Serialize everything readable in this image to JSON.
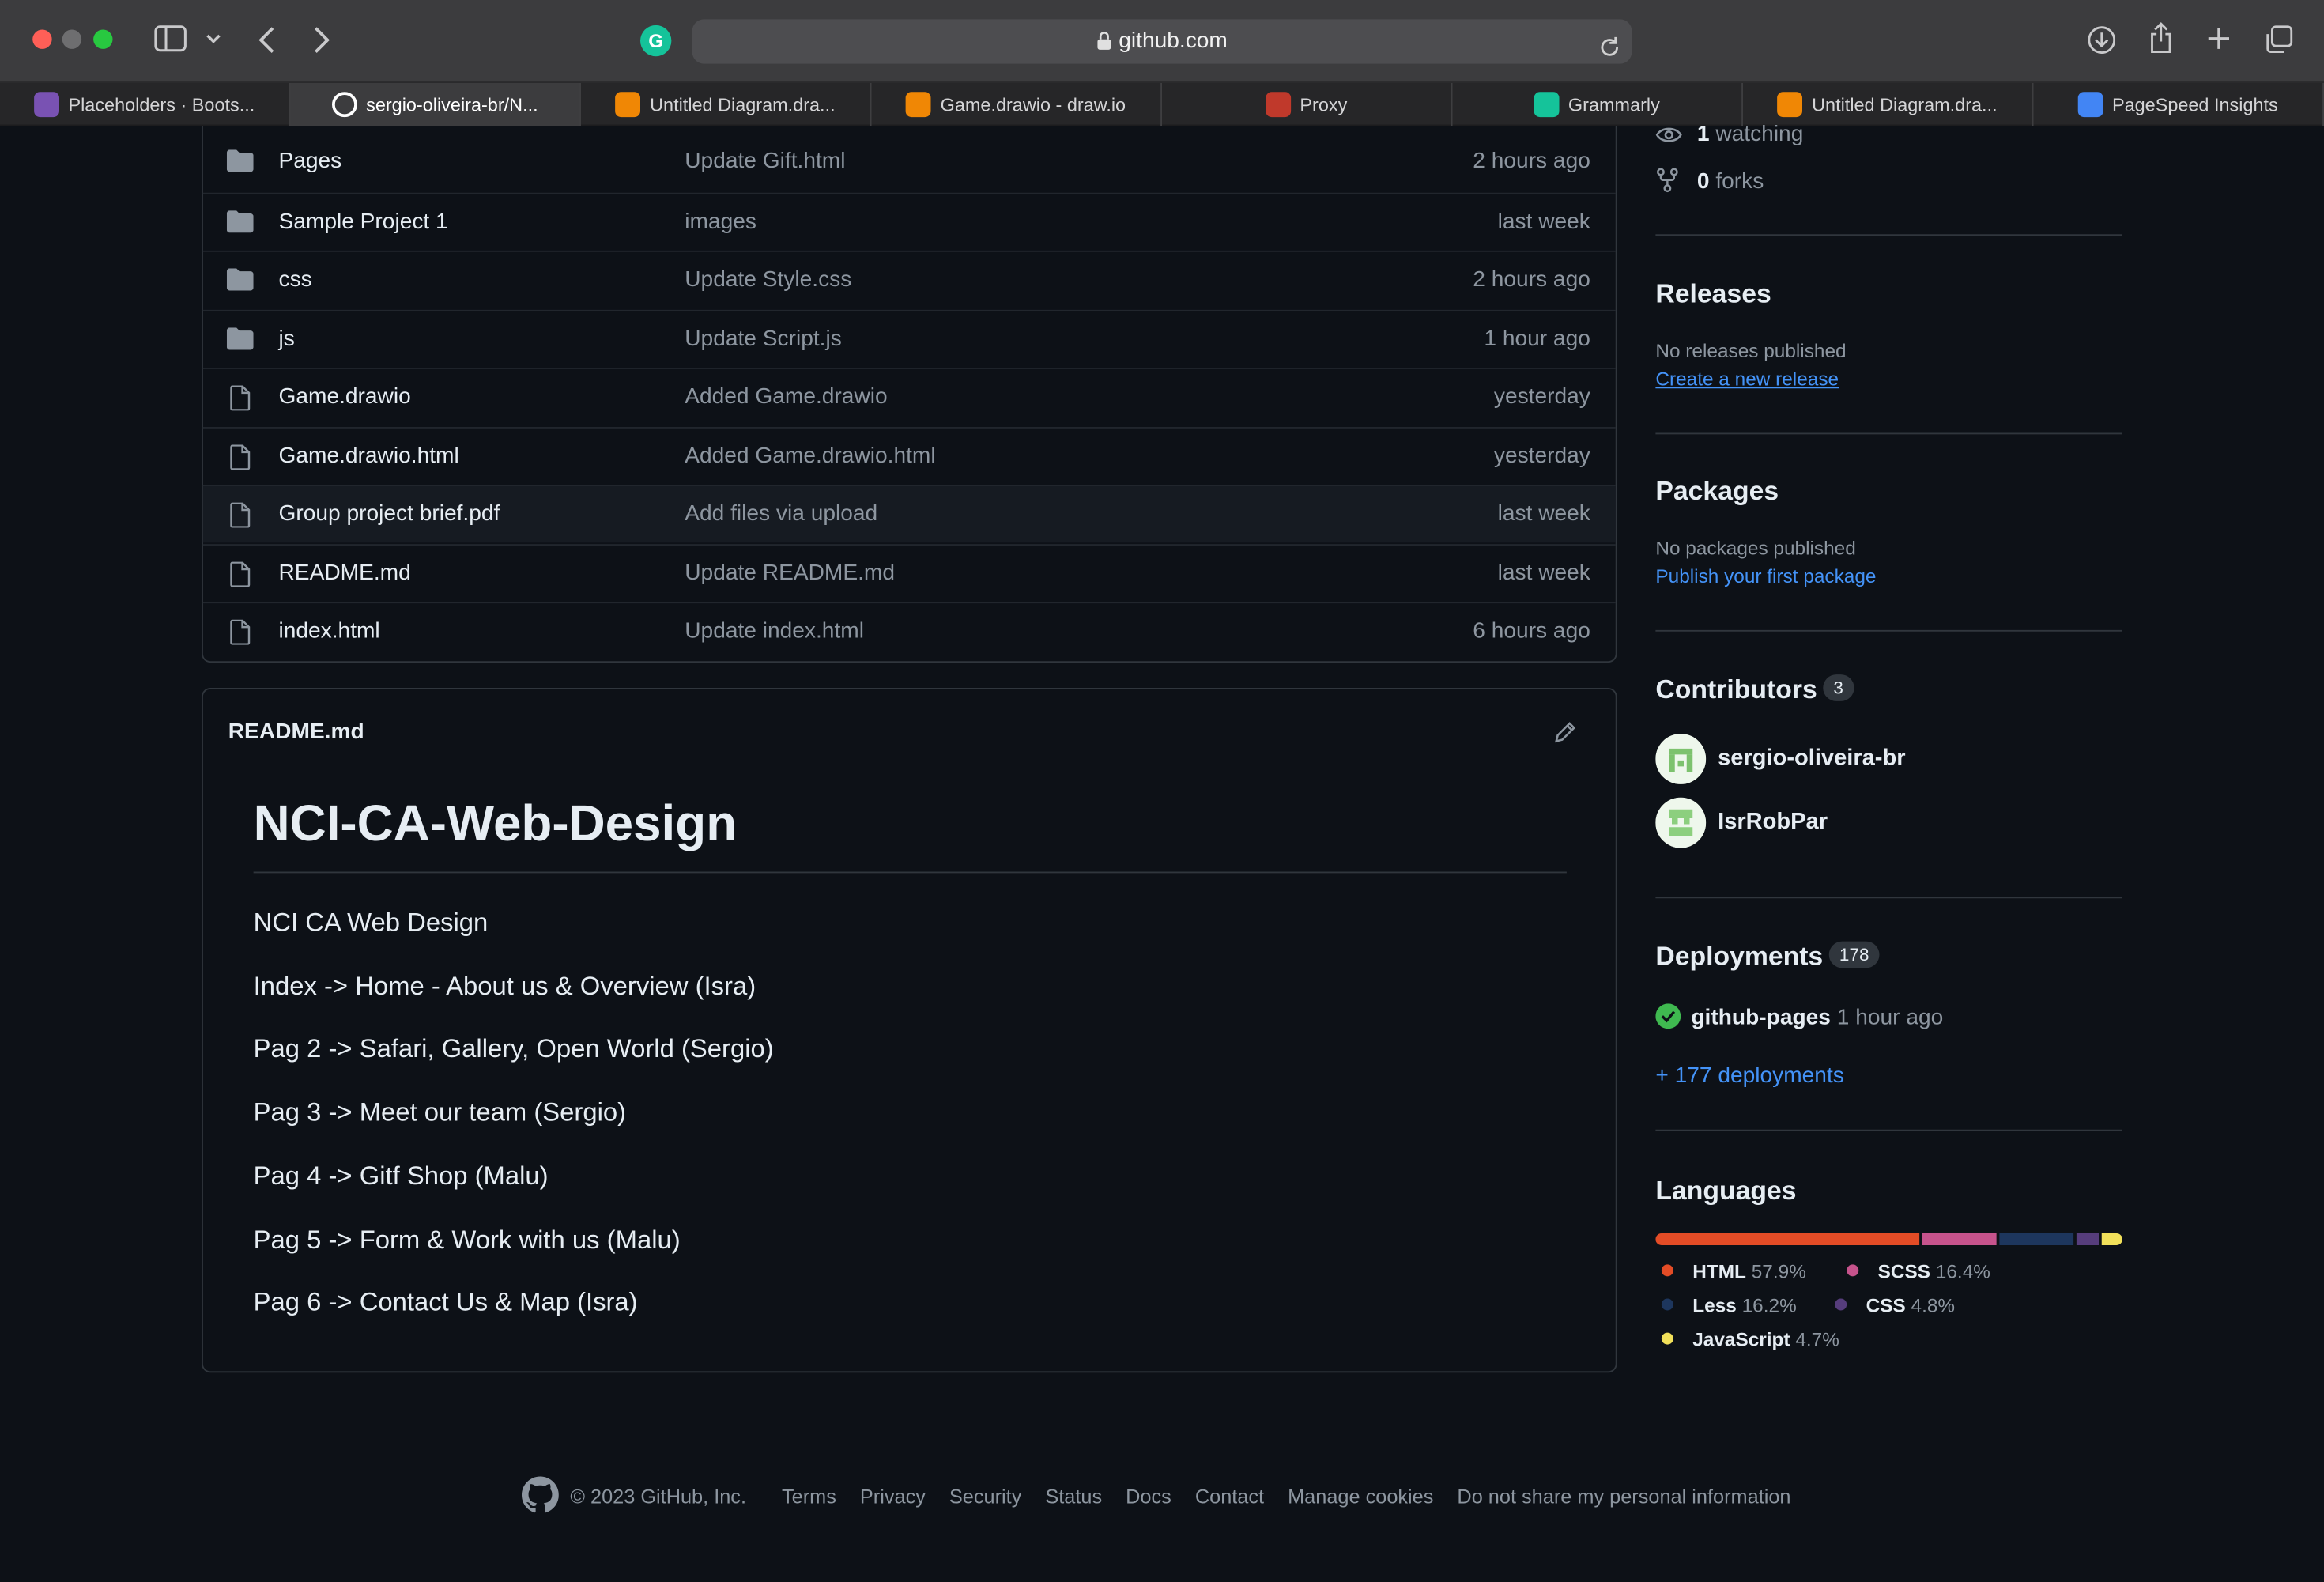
{
  "browser": {
    "url": "github.com",
    "tabs": [
      {
        "label": "Placeholders · Boots...",
        "icon": "bootstrap-icon",
        "color": "#7952b3"
      },
      {
        "label": "sergio-oliveira-br/N...",
        "icon": "github-icon",
        "color": "#ffffff",
        "active": true
      },
      {
        "label": "Untitled Diagram.dra...",
        "icon": "drawio-icon",
        "color": "#f08705"
      },
      {
        "label": "Game.drawio - draw.io",
        "icon": "drawio-icon",
        "color": "#f08705"
      },
      {
        "label": "Proxy",
        "icon": "proxy-icon",
        "color": "#c0392b"
      },
      {
        "label": "Grammarly",
        "icon": "grammarly-icon",
        "color": "#15c39a"
      },
      {
        "label": "Untitled Diagram.dra...",
        "icon": "drawio-icon",
        "color": "#f08705"
      },
      {
        "label": "PageSpeed Insights",
        "icon": "pagespeed-icon",
        "color": "#4285f4"
      }
    ]
  },
  "files": [
    {
      "name": "Pages",
      "type": "folder",
      "message": "Update Gift.html",
      "date": "2 hours ago"
    },
    {
      "name": "Sample Project 1",
      "type": "folder",
      "message": "images",
      "date": "last week"
    },
    {
      "name": "css",
      "type": "folder",
      "message": "Update Style.css",
      "date": "2 hours ago"
    },
    {
      "name": "js",
      "type": "folder",
      "message": "Update Script.js",
      "date": "1 hour ago"
    },
    {
      "name": "Game.drawio",
      "type": "file",
      "message": "Added Game.drawio",
      "date": "yesterday"
    },
    {
      "name": "Game.drawio.html",
      "type": "file",
      "message": "Added Game.drawio.html",
      "date": "yesterday"
    },
    {
      "name": "Group project brief.pdf",
      "type": "file",
      "message": "Add files via upload",
      "date": "last week",
      "highlighted": true
    },
    {
      "name": "README.md",
      "type": "file",
      "message": "Update README.md",
      "date": "last week"
    },
    {
      "name": "index.html",
      "type": "file",
      "message": "Update index.html",
      "date": "6 hours ago"
    }
  ],
  "readme": {
    "header": "README.md",
    "title": "NCI-CA-Web-Design",
    "lines": [
      "NCI CA Web Design",
      "Index -> Home - About us & Overview (Isra)",
      "Pag 2 -> Safari, Gallery, Open World (Sergio)",
      "Pag 3 -> Meet our team (Sergio)",
      "Pag 4 -> Gitf Shop (Malu)",
      "Pag 5 -> Form & Work with us (Malu)",
      "Pag 6 -> Contact Us & Map (Isra)"
    ]
  },
  "sidebar": {
    "watching_count": "1",
    "watching_label": "watching",
    "forks_count": "0",
    "forks_label": "forks",
    "releases": {
      "title": "Releases",
      "empty": "No releases published",
      "link": "Create a new release"
    },
    "packages": {
      "title": "Packages",
      "empty": "No packages published",
      "link": "Publish your first package"
    },
    "contributors": {
      "title": "Contributors",
      "count": "3",
      "people": [
        {
          "name": "sergio-oliveira-br"
        },
        {
          "name": "IsrRobPar"
        }
      ]
    },
    "deployments": {
      "title": "Deployments",
      "count": "178",
      "env": "github-pages",
      "time": "1 hour ago",
      "more": "+ 177 deployments",
      "status_color": "#3fb950"
    },
    "languages": {
      "title": "Languages",
      "items": [
        {
          "name": "HTML",
          "percent": "57.9%",
          "value": 57.9,
          "color": "#e34c26"
        },
        {
          "name": "SCSS",
          "percent": "16.4%",
          "value": 16.4,
          "color": "#c6538c"
        },
        {
          "name": "Less",
          "percent": "16.2%",
          "value": 16.2,
          "color": "#1d365d"
        },
        {
          "name": "CSS",
          "percent": "4.8%",
          "value": 4.8,
          "color": "#563d7c"
        },
        {
          "name": "JavaScript",
          "percent": "4.7%",
          "value": 4.7,
          "color": "#f1e05a"
        }
      ]
    }
  },
  "footer": {
    "copyright": "© 2023 GitHub, Inc.",
    "links": [
      "Terms",
      "Privacy",
      "Security",
      "Status",
      "Docs",
      "Contact",
      "Manage cookies",
      "Do not share my personal information"
    ]
  }
}
